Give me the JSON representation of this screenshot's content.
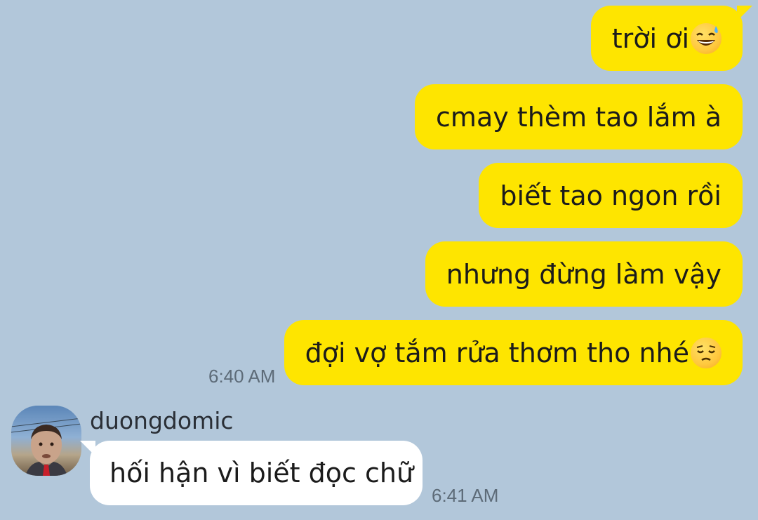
{
  "chat": {
    "outgoing": [
      {
        "text": "trời ơi",
        "emoji": "grinning-sweat-emoji"
      },
      {
        "text": "cmay thèm tao lắm à"
      },
      {
        "text": "biết tao ngon rồi"
      },
      {
        "text": "nhưng đừng làm vậy"
      },
      {
        "text": "đợi vợ tắm rửa thơm tho nhé",
        "emoji": "pensive-emoji"
      }
    ],
    "outgoing_time": "6:40 AM",
    "incoming": {
      "sender": "duongdomic",
      "text": "hối hận vì biết đọc chữ",
      "time": "6:41 AM"
    }
  },
  "colors": {
    "background": "#b2c7da",
    "outgoing_bubble": "#fee500",
    "incoming_bubble": "#ffffff"
  }
}
